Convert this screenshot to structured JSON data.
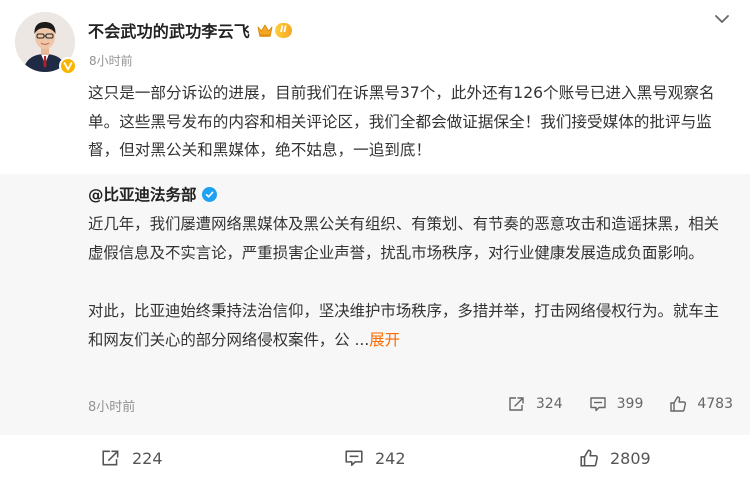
{
  "post": {
    "author": "不会武功的武功李云飞",
    "level_badge": "II",
    "time": "8小时前",
    "text": "这只是一部分诉讼的进展，目前我们在诉黑号37个，此外还有126个账号已进入黑号观察名单。这些黑号发布的内容和相关评论区，我们全都会做证据保全！我们接受媒体的批评与监督，但对黑公关和黑媒体，绝不姑息，一追到底！"
  },
  "repost": {
    "author": "@比亚迪法务部",
    "paragraph1": "近几年，我们屡遭网络黑媒体及黑公关有组织、有策划、有节奏的恶意攻击和造谣抹黑，相关虚假信息及不实言论，严重损害企业声誉，扰乱市场秩序，对行业健康发展造成负面影响。",
    "paragraph2": "对此，比亚迪始终秉持法治信仰，坚决维护市场秩序，多措并举，打击网络侵权行为。就车主和网友们关心的部分网络侵权案件，公 ...",
    "expand_label": "展开",
    "time": "8小时前",
    "reposts": "324",
    "comments": "399",
    "likes": "4783"
  },
  "actions": {
    "reposts": "224",
    "comments": "242",
    "likes": "2809"
  },
  "icons": {
    "avatar": "avatar-man-suit",
    "verified": "orange-v-badge",
    "crown": "crown-icon",
    "blue_verified": "blue-v-check",
    "more": "chevron-down-icon",
    "repost": "share-icon",
    "comment": "comment-icon",
    "like": "thumb-up-icon"
  },
  "colors": {
    "accent": "#ff6a00",
    "verified_orange": "#f7b500",
    "verified_blue": "#1da1f2",
    "repost_bg": "#f7f7f7",
    "muted": "#939393"
  }
}
